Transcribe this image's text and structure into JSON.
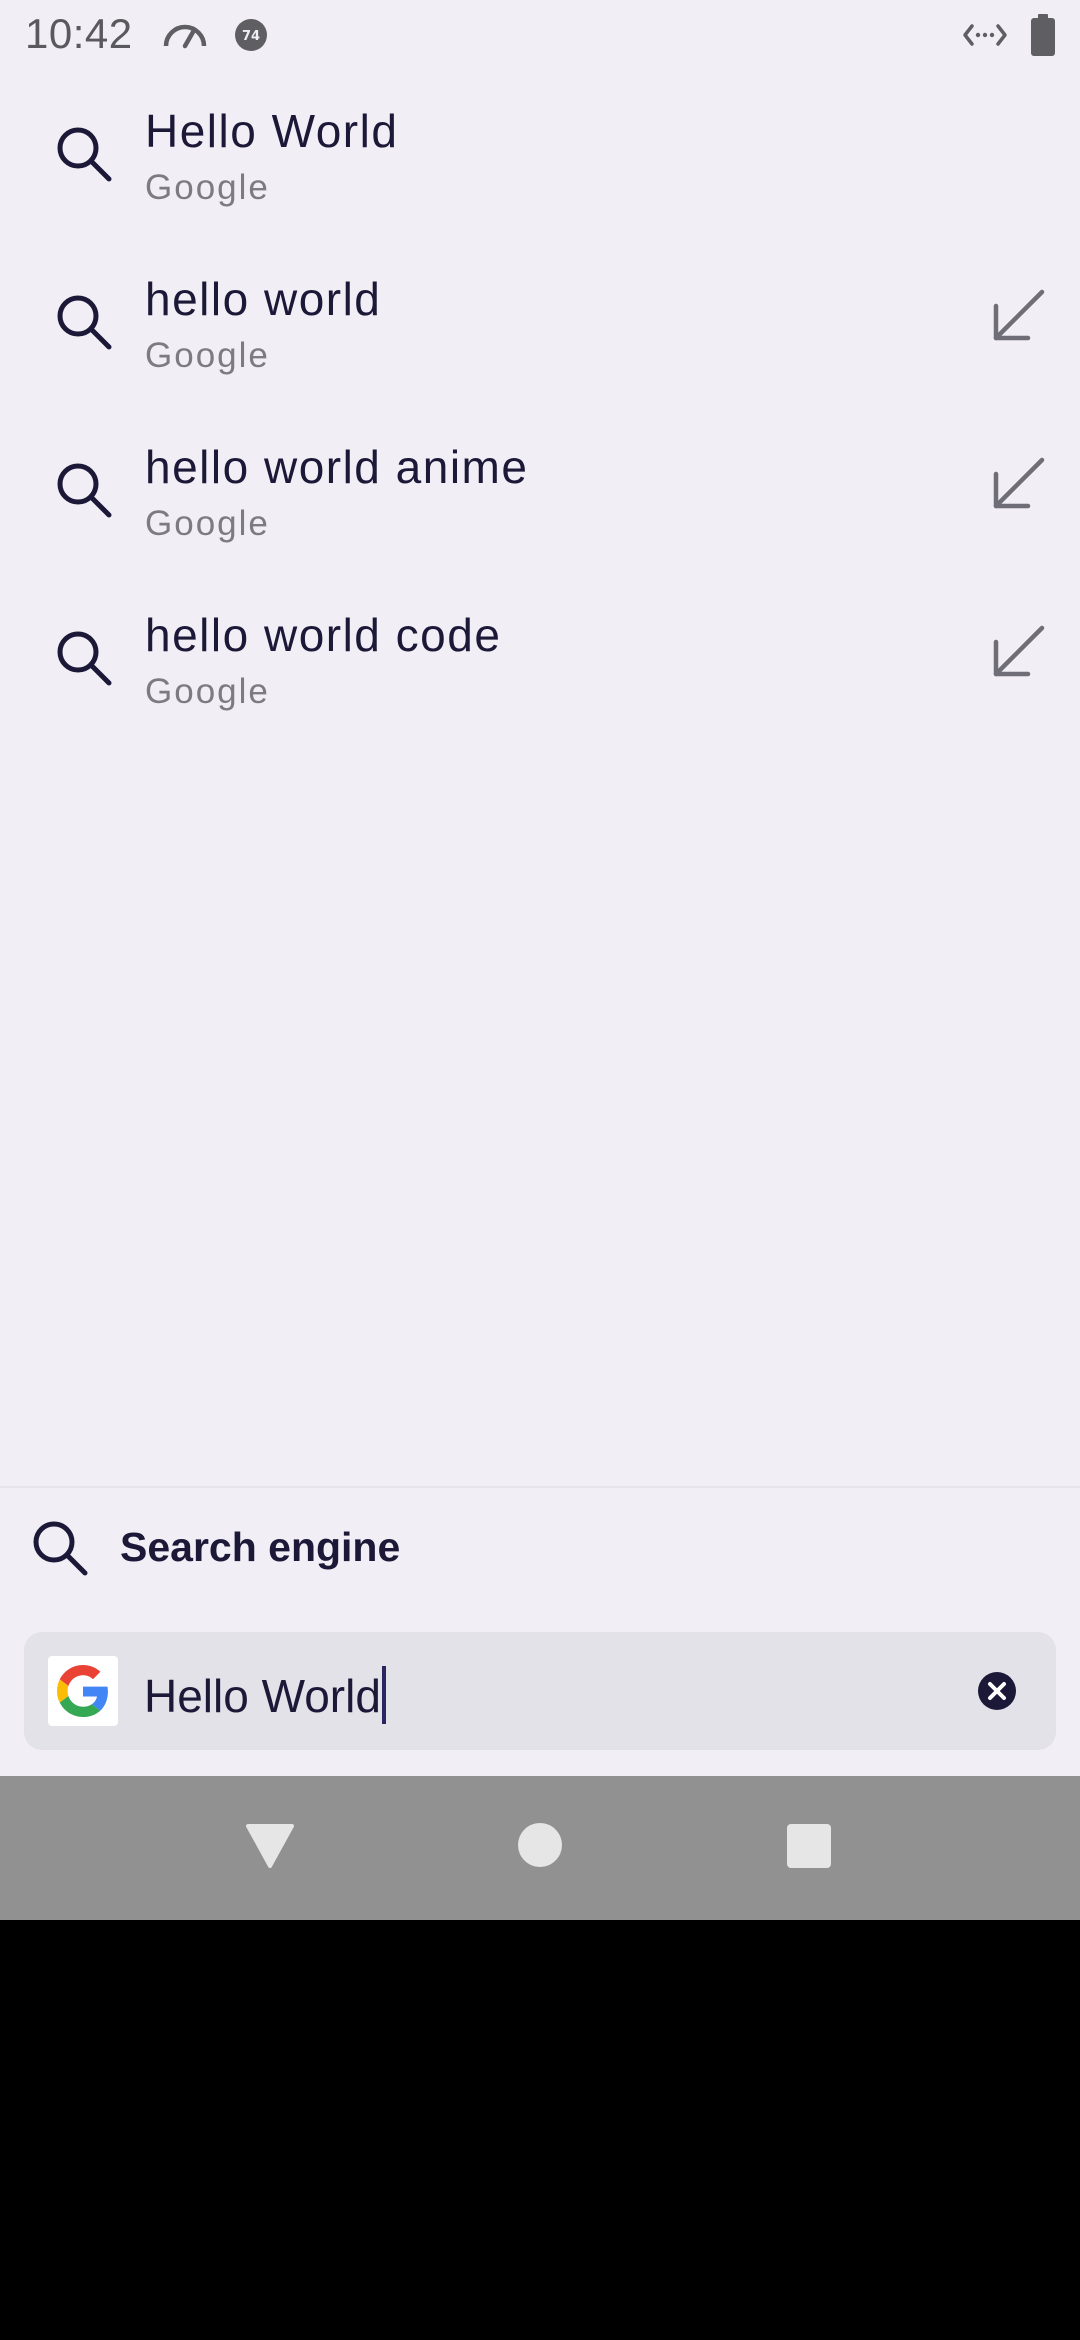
{
  "status_bar": {
    "time": "10:42",
    "badge_text": "74",
    "icons": [
      "speedometer-icon",
      "notification-badge-icon",
      "code-arrows-icon",
      "battery-icon"
    ]
  },
  "suggestions": [
    {
      "title": "Hello World",
      "subtitle": "Google",
      "has_fill_arrow": false
    },
    {
      "title": "hello world",
      "subtitle": "Google",
      "has_fill_arrow": true
    },
    {
      "title": "hello world anime",
      "subtitle": "Google",
      "has_fill_arrow": true
    },
    {
      "title": "hello world code",
      "subtitle": "Google",
      "has_fill_arrow": true
    }
  ],
  "engine_row": {
    "label": "Search engine",
    "icon": "search-icon"
  },
  "search_box": {
    "value": "Hello World",
    "engine_logo": "google-logo-icon",
    "clear_icon": "clear-icon"
  },
  "nav_bar": {
    "buttons": [
      "back-icon",
      "home-icon",
      "recents-icon"
    ]
  },
  "colors": {
    "background": "#f1eff5",
    "text_primary": "#1c1838",
    "text_secondary": "#7c7a82",
    "search_box": "#e3e2e8",
    "nav_bar": "#919191"
  }
}
